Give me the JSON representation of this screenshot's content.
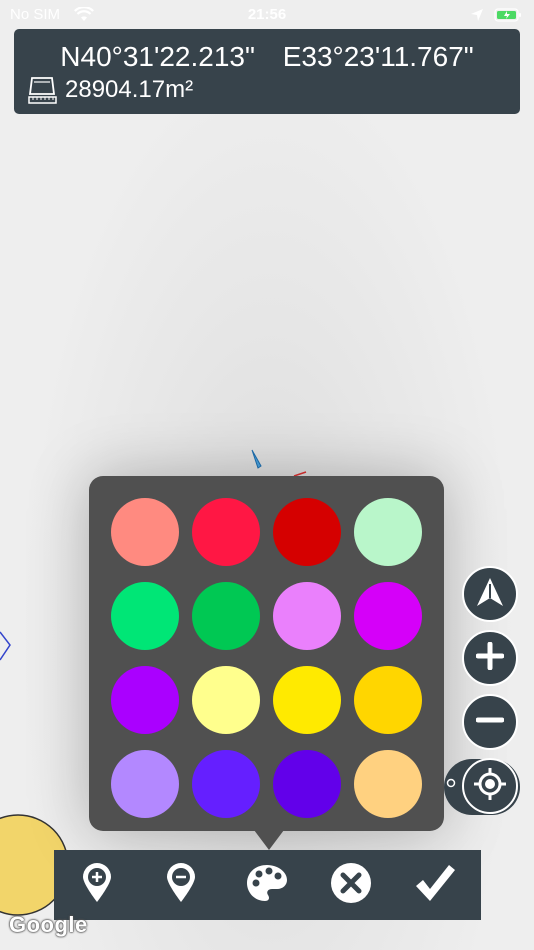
{
  "status_bar": {
    "carrier": "No SIM",
    "time": "21:56"
  },
  "info_panel": {
    "latitude": "N40°31'22.213\"",
    "longitude": "E33°23'11.767\"",
    "area": "28904.17m²"
  },
  "color_palette": {
    "colors": [
      "#FF8A80",
      "#FF1744",
      "#D50000",
      "#B9F6CA",
      "#00E676",
      "#00C853",
      "#EA80FC",
      "#D500F9",
      "#AA00FF",
      "#FFFF8D",
      "#FFEA00",
      "#FFD600",
      "#B388FF",
      "#651FFF",
      "#6200EA",
      "#FFD180"
    ]
  },
  "map_controls": {
    "icons": [
      "navigation-arrow-icon",
      "zoom-in-icon",
      "zoom-out-icon",
      "my-location-icon"
    ]
  },
  "toolbar": {
    "icons": [
      "add-marker-icon",
      "remove-marker-icon",
      "palette-icon",
      "close-icon",
      "checkmark-icon"
    ]
  },
  "map": {
    "logo": "Google"
  },
  "colors": {
    "panel": "#37434b",
    "palette_bg": "#505050"
  }
}
